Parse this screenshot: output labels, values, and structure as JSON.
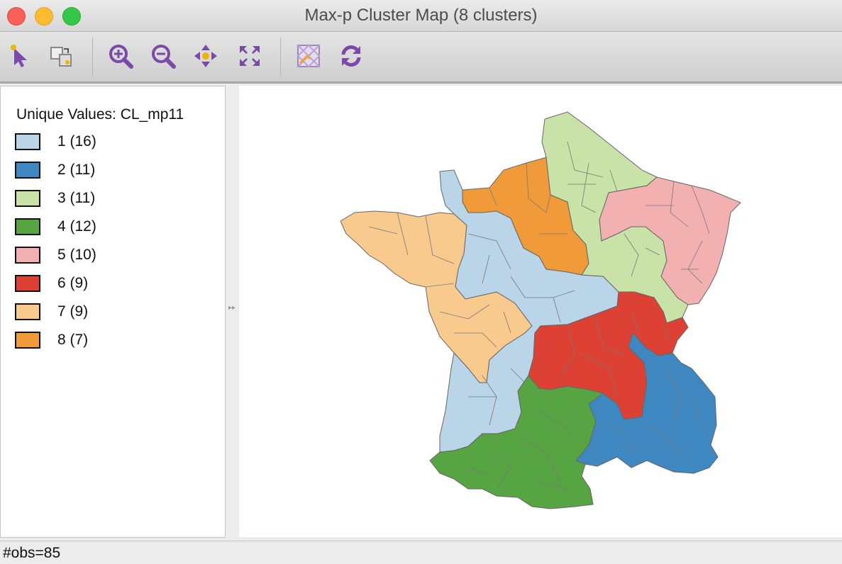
{
  "window": {
    "title": "Max-p Cluster Map (8 clusters)"
  },
  "toolbar": {
    "buttons": [
      {
        "name": "select-tool",
        "icon": "select-arrow-icon"
      },
      {
        "name": "selection-shape",
        "icon": "selection-shape-icon"
      },
      {
        "name": "zoom-in",
        "icon": "zoom-in-icon"
      },
      {
        "name": "zoom-out",
        "icon": "zoom-out-icon"
      },
      {
        "name": "pan",
        "icon": "pan-icon"
      },
      {
        "name": "full-extent",
        "icon": "full-extent-icon"
      },
      {
        "name": "basemap",
        "icon": "basemap-icon"
      },
      {
        "name": "refresh",
        "icon": "refresh-icon"
      }
    ],
    "accent_color": "#7b4aa8"
  },
  "legend": {
    "title": "Unique Values: CL_mp11",
    "items": [
      {
        "label": "1 (16)",
        "color": "#bad4e8"
      },
      {
        "label": "2 (11)",
        "color": "#3f87c0"
      },
      {
        "label": "3 (11)",
        "color": "#c8e2a8"
      },
      {
        "label": "4 (12)",
        "color": "#57a443"
      },
      {
        "label": "5 (10)",
        "color": "#f2b1b0"
      },
      {
        "label": "6 (9)",
        "color": "#dc4134"
      },
      {
        "label": "7 (9)",
        "color": "#f8ca8e"
      },
      {
        "label": "8 (7)",
        "color": "#f19a3a"
      }
    ]
  },
  "map": {
    "description_color_borders": "#666666",
    "regions": [
      {
        "cluster": 1
      },
      {
        "cluster": 2
      },
      {
        "cluster": 3
      },
      {
        "cluster": 4
      },
      {
        "cluster": 5
      },
      {
        "cluster": 6
      },
      {
        "cluster": 7
      },
      {
        "cluster": 8
      }
    ]
  },
  "status": {
    "text": "#obs=85"
  }
}
